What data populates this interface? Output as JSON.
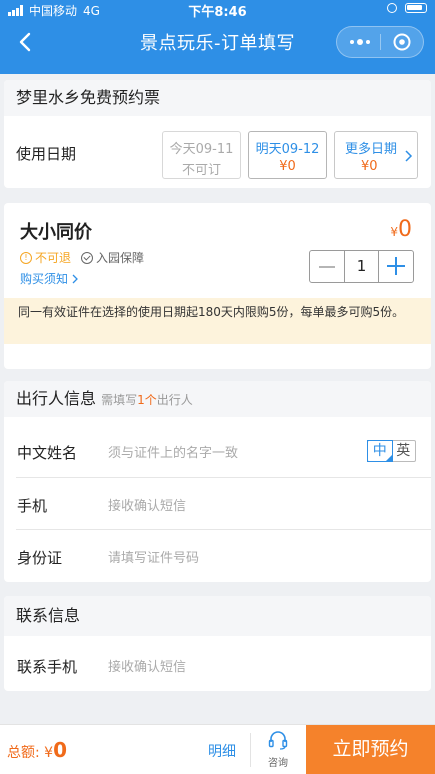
{
  "status_bar": {
    "carrier": "中国移动",
    "network": "4G",
    "time": "下午8:46"
  },
  "nav": {
    "title": "景点玩乐-订单填写",
    "icons": [
      "back-icon",
      "more-icon",
      "close-mini-icon"
    ]
  },
  "ticket": {
    "name": "梦里水乡免费预约票",
    "date_label": "使用日期",
    "dates": [
      {
        "line1": "今天09-11",
        "line2": "不可订",
        "state": "disabled"
      },
      {
        "line1": "明天09-12",
        "line2": "¥0",
        "state": "available"
      },
      {
        "line1": "更多日期",
        "line2": "¥0",
        "state": "more"
      }
    ]
  },
  "price": {
    "title": "大小同价",
    "currency": "¥",
    "amount": "0",
    "tag_nonrefund": "不可退",
    "tag_guarantee": "入园保障",
    "notice_link": "购买须知",
    "quantity": "1",
    "limit_note": "同一有效证件在选择的使用日期起180天内限购5份，每单最多可购5份。"
  },
  "traveler": {
    "title": "出行人信息",
    "sub_prefix": "需填写",
    "sub_count": "1个",
    "sub_suffix": "出行人",
    "fields": {
      "name_label": "中文姓名",
      "name_placeholder": "须与证件上的名字一致",
      "phone_label": "手机",
      "phone_placeholder": "接收确认短信",
      "id_label": "身份证",
      "id_placeholder": "请填写证件号码"
    },
    "lang_zh": "中",
    "lang_en": "英"
  },
  "contact": {
    "title": "联系信息",
    "phone_label": "联系手机",
    "phone_placeholder": "接收确认短信"
  },
  "footer": {
    "total_label": "总额:",
    "currency": "¥",
    "total_amount": "0",
    "detail_label": "明细",
    "consult_label": "咨询",
    "book_label": "立即预约"
  },
  "colors": {
    "brand_blue": "#2e8fe6",
    "accent_orange": "#f06a1a",
    "book_button": "#f5822b",
    "notice_bg": "#fdf3dc"
  }
}
